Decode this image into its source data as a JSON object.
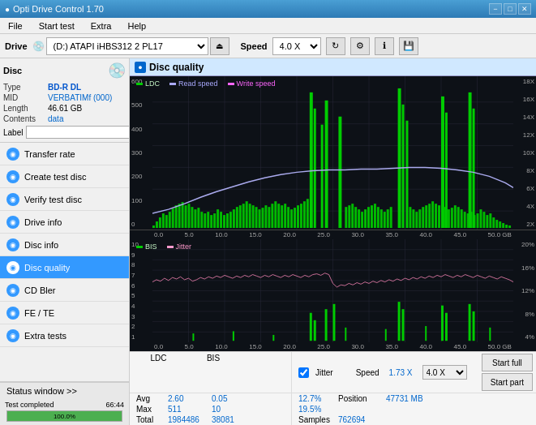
{
  "titlebar": {
    "title": "Opti Drive Control 1.70",
    "minimize": "−",
    "maximize": "□",
    "close": "✕"
  },
  "menubar": {
    "items": [
      "File",
      "Start test",
      "Extra",
      "Help"
    ]
  },
  "drivebar": {
    "label": "Drive",
    "drive_value": "(D:) ATAPI iHBS312 2 PL17",
    "speed_label": "Speed",
    "speed_value": "4.0 X"
  },
  "disc": {
    "title": "Disc",
    "type_label": "Type",
    "type_value": "BD-R DL",
    "mid_label": "MID",
    "mid_value": "VERBATIMf (000)",
    "length_label": "Length",
    "length_value": "46.61 GB",
    "contents_label": "Contents",
    "contents_value": "data",
    "label_label": "Label"
  },
  "nav": {
    "items": [
      {
        "id": "transfer-rate",
        "label": "Transfer rate",
        "active": false
      },
      {
        "id": "create-test-disc",
        "label": "Create test disc",
        "active": false
      },
      {
        "id": "verify-test-disc",
        "label": "Verify test disc",
        "active": false
      },
      {
        "id": "drive-info",
        "label": "Drive info",
        "active": false
      },
      {
        "id": "disc-info",
        "label": "Disc info",
        "active": false
      },
      {
        "id": "disc-quality",
        "label": "Disc quality",
        "active": true
      },
      {
        "id": "cd-bler",
        "label": "CD Bler",
        "active": false
      },
      {
        "id": "fe-te",
        "label": "FE / TE",
        "active": false
      },
      {
        "id": "extra-tests",
        "label": "Extra tests",
        "active": false
      }
    ]
  },
  "status": {
    "label": "Status window >>",
    "progress_pct": 100,
    "progress_text": "100.0%",
    "status_text": "Test completed",
    "time_text": "66:44"
  },
  "panel": {
    "title": "Disc quality",
    "icon": "●"
  },
  "chart_top": {
    "legend": [
      {
        "label": "LDC",
        "color": "#00aa00"
      },
      {
        "label": "Read speed",
        "color": "#aaaaff"
      },
      {
        "label": "Write speed",
        "color": "#ff66ff"
      }
    ],
    "y_axis_left": [
      "600",
      "500",
      "400",
      "300",
      "200",
      "100",
      "0"
    ],
    "y_axis_right": [
      "18X",
      "16X",
      "14X",
      "12X",
      "10X",
      "8X",
      "6X",
      "4X",
      "2X"
    ],
    "x_axis": [
      "0.0",
      "5.0",
      "10.0",
      "15.0",
      "20.0",
      "25.0",
      "30.0",
      "35.0",
      "40.0",
      "45.0",
      "50.0 GB"
    ]
  },
  "chart_bottom": {
    "legend": [
      {
        "label": "BIS",
        "color": "#00aa00"
      },
      {
        "label": "Jitter",
        "color": "#ff99cc"
      }
    ],
    "y_axis_left": [
      "10",
      "9",
      "8",
      "7",
      "6",
      "5",
      "4",
      "3",
      "2",
      "1"
    ],
    "y_axis_right": [
      "20%",
      "16%",
      "12%",
      "8%",
      "4%"
    ],
    "x_axis": [
      "0.0",
      "5.0",
      "10.0",
      "15.0",
      "20.0",
      "25.0",
      "30.0",
      "35.0",
      "40.0",
      "45.0",
      "50.0 GB"
    ]
  },
  "stats": {
    "headers": [
      "LDC",
      "BIS",
      "",
      "Jitter",
      "Speed",
      ""
    ],
    "avg_label": "Avg",
    "avg_ldc": "2.60",
    "avg_bis": "0.05",
    "avg_jitter": "12.7%",
    "speed_label": "Speed",
    "speed_value": "1.73 X",
    "speed_select": "4.0 X",
    "max_label": "Max",
    "max_ldc": "511",
    "max_bis": "10",
    "max_jitter": "19.5%",
    "position_label": "Position",
    "position_value": "47731 MB",
    "total_label": "Total",
    "total_ldc": "1984486",
    "total_bis": "38081",
    "samples_label": "Samples",
    "samples_value": "762694",
    "start_full_label": "Start full",
    "start_part_label": "Start part",
    "jitter_checked": true,
    "jitter_label": "Jitter"
  }
}
